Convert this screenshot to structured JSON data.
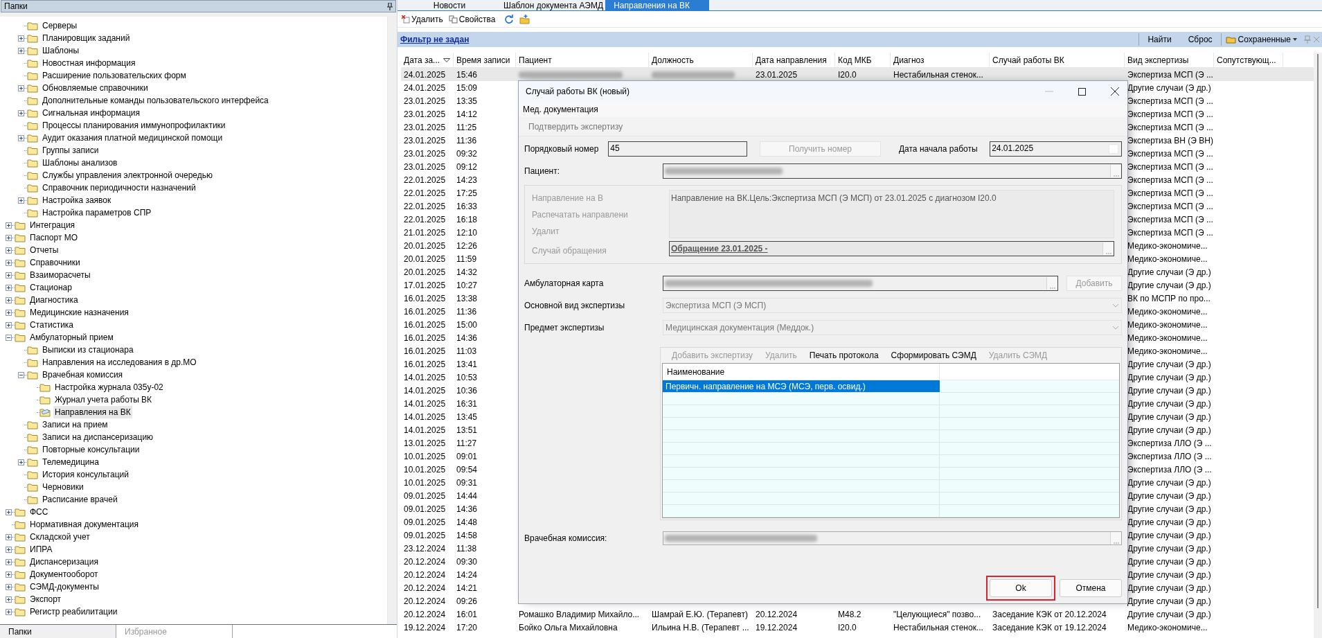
{
  "left_panel": {
    "title": "Папки",
    "tree_partial": [
      {
        "label": "Серверы",
        "kind": "leaf",
        "selected": false
      },
      {
        "label": "Планировщик заданий",
        "kind": "collapsed",
        "selected": false
      },
      {
        "label": "Шаблоны",
        "kind": "collapsed",
        "selected": false
      },
      {
        "label": "Новостная информация",
        "kind": "leaf",
        "selected": false
      },
      {
        "label": "Расширение пользовательских форм",
        "kind": "leaf",
        "selected": false
      },
      {
        "label": "Обновляемые справочники",
        "kind": "collapsed",
        "selected": false
      },
      {
        "label": "Дополнительные команды пользовательского интерфейса",
        "kind": "leaf",
        "selected": false
      },
      {
        "label": "Сигнальная информация",
        "kind": "collapsed",
        "selected": false
      },
      {
        "label": "Процессы планирования иммунопрофилактики",
        "kind": "leaf",
        "selected": false
      },
      {
        "label": "Аудит оказания платной медицинской помощи",
        "kind": "collapsed",
        "selected": false
      },
      {
        "label": "Группы записи",
        "kind": "leaf",
        "selected": false
      },
      {
        "label": "Шаблоны анализов",
        "kind": "leaf",
        "selected": false
      },
      {
        "label": "Службы управления электронной очередью",
        "kind": "leaf",
        "selected": false
      },
      {
        "label": "Справочник периодичности назначений",
        "kind": "leaf",
        "selected": false
      },
      {
        "label": "Настройка заявок",
        "kind": "collapsed",
        "selected": false
      },
      {
        "label": "Настройка параметров СПР",
        "kind": "leaf",
        "selected": false
      }
    ],
    "tree": [
      {
        "label": "Интеграция",
        "kind": "collapsed",
        "selected": false
      },
      {
        "label": "Паспорт МО",
        "kind": "collapsed",
        "selected": false
      },
      {
        "label": "Отчеты",
        "kind": "collapsed",
        "selected": false
      },
      {
        "label": "Справочники",
        "kind": "collapsed",
        "selected": false
      },
      {
        "label": "Взаиморасчеты",
        "kind": "collapsed",
        "selected": false
      },
      {
        "label": "Стационар",
        "kind": "collapsed",
        "selected": false
      },
      {
        "label": "Диагностика",
        "kind": "collapsed",
        "selected": false
      },
      {
        "label": "Медицинские назначения",
        "kind": "collapsed",
        "selected": false
      },
      {
        "label": "Статистика",
        "kind": "collapsed",
        "selected": false
      },
      {
        "label": "Амбулаторный прием",
        "kind": "expanded",
        "selected": false,
        "children": [
          {
            "label": "Выписки из стационара",
            "kind": "leaf",
            "selected": false
          },
          {
            "label": "Направления на исследования в др.МО",
            "kind": "leaf",
            "selected": false
          },
          {
            "label": "Врачебная комиссия",
            "kind": "expanded",
            "selected": false,
            "children": [
              {
                "label": "Настройка журнала 035у-02",
                "kind": "leaf",
                "selected": false
              },
              {
                "label": "Журнал учета работы ВК",
                "kind": "leaf",
                "selected": false
              },
              {
                "label": "Направления на ВК",
                "kind": "leaf",
                "selected": true
              }
            ]
          },
          {
            "label": "Записи на прием",
            "kind": "leaf",
            "selected": false
          },
          {
            "label": "Записи на диспансеризацию",
            "kind": "leaf",
            "selected": false
          },
          {
            "label": "Повторные консультации",
            "kind": "leaf",
            "selected": false
          },
          {
            "label": "Телемедицина",
            "kind": "collapsed",
            "selected": false
          },
          {
            "label": "История консультаций",
            "kind": "leaf",
            "selected": false
          },
          {
            "label": "Черновики",
            "kind": "leaf",
            "selected": false
          },
          {
            "label": "Расписание врачей",
            "kind": "leaf",
            "selected": false
          }
        ]
      },
      {
        "label": "ФСС",
        "kind": "collapsed",
        "selected": false
      },
      {
        "label": "Нормативная документация",
        "kind": "leaf",
        "selected": false
      },
      {
        "label": "Складской учет",
        "kind": "collapsed",
        "selected": false
      },
      {
        "label": "ИПРА",
        "kind": "collapsed",
        "selected": false
      },
      {
        "label": "Диспансеризация",
        "kind": "collapsed",
        "selected": false
      },
      {
        "label": "Документооборот",
        "kind": "collapsed",
        "selected": false
      },
      {
        "label": "СЭМД-документы",
        "kind": "collapsed",
        "selected": false
      },
      {
        "label": "Экспорт",
        "kind": "collapsed",
        "selected": false
      },
      {
        "label": "Регистр реабилитации",
        "kind": "collapsed",
        "selected": false
      }
    ],
    "bottom_tabs": [
      {
        "label": "Папки",
        "selected": true
      },
      {
        "label": "Избранное",
        "selected": false
      }
    ]
  },
  "tabs": [
    {
      "label": "Новости",
      "selected": false
    },
    {
      "label": "Шаблон документа АЭМД",
      "selected": false
    },
    {
      "label": "Направления на ВК",
      "selected": true
    }
  ],
  "toolbar": [
    {
      "kind": "delete",
      "label": "Удалить"
    },
    {
      "kind": "properties",
      "label": "Свойства"
    },
    {
      "kind": "refresh"
    },
    {
      "kind": "folder"
    }
  ],
  "filter_bar": {
    "filter_link": "Фильтр не задан",
    "find": "Найти",
    "reset": "Сброс",
    "saved": "Сохраненные"
  },
  "table": {
    "columns": [
      "Дата за...",
      "Время записи",
      "Пациент",
      "Должность",
      "Дата направления",
      "Код МКБ",
      "Диагноз",
      "Случай работы ВК",
      "Вид экспертизы",
      "Сопутствующ..."
    ],
    "rows": [
      {
        "selected": true,
        "blurred": true,
        "date": "24.01.2025",
        "time": "15:46",
        "referral_date": "23.01.2025",
        "icd": "I20.0",
        "diagnosis": "Нестабильная стенок...",
        "exam_type": "Экспертиза МСП (Э ..."
      },
      {
        "selected": false,
        "blurred": false,
        "date": "24.01.2025",
        "time": "15:09",
        "exam_type": "Другие случаи (Э др.)"
      },
      {
        "selected": false,
        "blurred": false,
        "date": "23.01.2025",
        "time": "13:35",
        "exam_type": "Экспертиза МСП (Э ..."
      },
      {
        "selected": false,
        "blurred": false,
        "date": "23.01.2025",
        "time": "14:12",
        "exam_type": "Экспертиза МСП (Э ..."
      },
      {
        "selected": false,
        "blurred": false,
        "date": "23.01.2025",
        "time": "11:25",
        "exam_type": "Экспертиза МСП (Э ..."
      },
      {
        "selected": false,
        "blurred": false,
        "date": "23.01.2025",
        "time": "11:36",
        "exam_type": "Экспертиза ВН (Э ВН)"
      },
      {
        "selected": false,
        "blurred": false,
        "date": "23.01.2025",
        "time": "09:32",
        "exam_type": "Экспертиза МСП (Э ..."
      },
      {
        "selected": false,
        "blurred": false,
        "date": "23.01.2025",
        "time": "09:12",
        "exam_type": "Экспертиза МСП (Э ..."
      },
      {
        "selected": false,
        "blurred": false,
        "date": "22.01.2025",
        "time": "14:23",
        "exam_type": "Экспертиза МСП (Э ..."
      },
      {
        "selected": false,
        "blurred": false,
        "date": "22.01.2025",
        "time": "17:25",
        "exam_type": "Экспертиза МСП (Э ..."
      },
      {
        "selected": false,
        "blurred": false,
        "date": "22.01.2025",
        "time": "16:33",
        "exam_type": "Экспертиза МСП (Э ..."
      },
      {
        "selected": false,
        "blurred": false,
        "date": "22.01.2025",
        "time": "16:18",
        "exam_type": "Экспертиза МСП (Э ..."
      },
      {
        "selected": false,
        "blurred": false,
        "date": "21.01.2025",
        "time": "12:10",
        "exam_type": "Экспертиза МСП (Э ..."
      },
      {
        "selected": false,
        "blurred": false,
        "date": "20.01.2025",
        "time": "12:26",
        "exam_type": "Медико-экономиче..."
      },
      {
        "selected": false,
        "blurred": false,
        "date": "20.01.2025",
        "time": "11:59",
        "exam_type": "Медико-экономиче..."
      },
      {
        "selected": false,
        "blurred": false,
        "date": "20.01.2025",
        "time": "14:32",
        "exam_type": "Другие случаи (Э др.)"
      },
      {
        "selected": false,
        "blurred": false,
        "date": "17.01.2025",
        "time": "10:27",
        "exam_type": "Другие случаи (Э др.)"
      },
      {
        "selected": false,
        "blurred": false,
        "date": "16.01.2025",
        "time": "13:38",
        "exam_type": "ВК по МСПР по про..."
      },
      {
        "selected": false,
        "blurred": false,
        "date": "16.01.2025",
        "time": "11:36",
        "exam_type": "Медико-экономиче..."
      },
      {
        "selected": false,
        "blurred": false,
        "date": "16.01.2025",
        "time": "15:00",
        "exam_type": "Медико-экономиче..."
      },
      {
        "selected": false,
        "blurred": false,
        "date": "16.01.2025",
        "time": "14:36",
        "exam_type": "Медико-экономиче..."
      },
      {
        "selected": false,
        "blurred": false,
        "date": "16.01.2025",
        "time": "11:03",
        "exam_type": "Медико-экономиче..."
      },
      {
        "selected": false,
        "blurred": false,
        "date": "16.01.2025",
        "time": "13:41",
        "exam_type": "Другие случаи (Э др.)"
      },
      {
        "selected": false,
        "blurred": false,
        "date": "14.01.2025",
        "time": "10:53",
        "exam_type": "Другие случаи (Э др.)"
      },
      {
        "selected": false,
        "blurred": false,
        "date": "14.01.2025",
        "time": "10:36",
        "exam_type": "Другие случаи (Э др.)"
      },
      {
        "selected": false,
        "blurred": false,
        "date": "14.01.2025",
        "time": "16:31",
        "exam_type": "Другие случаи (Э др.)"
      },
      {
        "selected": false,
        "blurred": false,
        "date": "14.01.2025",
        "time": "13:45",
        "exam_type": "Другие случаи (Э др.)"
      },
      {
        "selected": false,
        "blurred": false,
        "date": "14.01.2025",
        "time": "13:51",
        "exam_type": "Другие случаи (Э др.)"
      },
      {
        "selected": false,
        "blurred": false,
        "date": "13.01.2025",
        "time": "11:27",
        "exam_type": "Экспертиза ЛЛО (Э ..."
      },
      {
        "selected": false,
        "blurred": false,
        "date": "10.01.2025",
        "time": "09:01",
        "exam_type": "Экспертиза ЛЛО (Э ..."
      },
      {
        "selected": false,
        "blurred": false,
        "date": "10.01.2025",
        "time": "09:54",
        "exam_type": "Экспертиза ЛЛО (Э ..."
      },
      {
        "selected": false,
        "blurred": false,
        "date": "10.01.2025",
        "time": "09:31",
        "exam_type": "Другие случаи (Э др.)"
      },
      {
        "selected": false,
        "blurred": false,
        "date": "09.01.2025",
        "time": "14:44",
        "exam_type": "Другие случаи (Э др.)"
      },
      {
        "selected": false,
        "blurred": false,
        "date": "09.01.2025",
        "time": "14:36",
        "exam_type": "Другие случаи (Э др.)"
      },
      {
        "selected": false,
        "blurred": false,
        "date": "09.01.2025",
        "time": "14:48",
        "exam_type": "Другие случаи (Э др.)"
      },
      {
        "selected": false,
        "blurred": false,
        "date": "09.01.2025",
        "time": "14:58",
        "exam_type": "Другие случаи (Э др.)"
      },
      {
        "selected": false,
        "blurred": false,
        "date": "23.12.2024",
        "time": "11:38",
        "exam_type": "Другие случаи (Э др.)"
      },
      {
        "selected": false,
        "blurred": false,
        "date": "20.12.2024",
        "time": "09:30",
        "exam_type": "Другие случаи (Э др.)"
      },
      {
        "selected": false,
        "blurred": false,
        "date": "20.12.2024",
        "time": "14:24",
        "exam_type": "Другие случаи (Э др.)"
      },
      {
        "selected": false,
        "blurred": false,
        "date": "20.12.2024",
        "time": "14:21",
        "exam_type": "Другие случаи (Э др.)"
      },
      {
        "selected": false,
        "blurred": false,
        "date": "20.12.2024",
        "time": "09:26",
        "exam_type": "Другие случаи (Э др.)"
      },
      {
        "selected": false,
        "blurred": false,
        "date": "20.12.2024",
        "time": "16:01",
        "patient": "Ромашко Владимир Михайло...",
        "position": "Шамрай Е.Ю. (Терапевт)",
        "referral_date": "20.12.2024",
        "icd": "M48.2",
        "diagnosis": "\"Целующиеся\" позво...",
        "vk_case": "Заседание КЭК от 20.12.2024",
        "exam_type": "Другие случаи (Э др.)"
      },
      {
        "selected": false,
        "blurred": false,
        "date": "19.12.2024",
        "time": "17:20",
        "patient": "Бойко Ольга Михайловна",
        "position": "Ильина Н.В. (Терапевт ...",
        "referral_date": "19.12.2024",
        "icd": "I20.0",
        "diagnosis": "Нестабильная стенок...",
        "vk_case": "Заседание КЭК от 19.12.2024",
        "exam_type": "Медико-экономиче..."
      }
    ]
  },
  "dialog": {
    "title": "Случай работы ВК (новый)",
    "menu": "Мед. документация",
    "confirm_action": "Подтвердить экспертизу",
    "serial_label": "Порядковый номер",
    "serial_value": "45",
    "get_number": "Получить номер",
    "start_date_label": "Дата начала работы",
    "start_date_value": "24.01.2025",
    "patient_label": "Пациент:",
    "group_links": [
      "Направление на В",
      "Распечатать направлени",
      "Удалит"
    ],
    "referral_text": "Направление на ВК.Цель:Экспертиза МСП (Э МСП) от 23.01.2025 с диагнозом I20.0",
    "case_label": "Случай обращения",
    "case_value": "Обращение 23.01.2025 -",
    "card_label": "Амбулаторная карта",
    "add_button": "Добавить",
    "main_type_label": "Основной вид экспертизы",
    "main_type_value": "Экспертиза МСП (Э МСП)",
    "subject_label": "Предмет экспертизы",
    "subject_value": "Медицинская документация (Меддок.)",
    "sub_toolbar": [
      {
        "label": "Добавить экспертизу",
        "disabled": true
      },
      {
        "label": "Удалить",
        "disabled": true
      },
      {
        "label": "Печать протокола",
        "disabled": false
      },
      {
        "label": "Сформировать СЭМД",
        "disabled": false
      },
      {
        "label": "Удалить СЭМД",
        "disabled": true
      }
    ],
    "grid_header": "Наименование",
    "grid_rows": [
      {
        "name": "Первичн. направление на МСЭ (МСЭ, перв. освид.)",
        "selected": true
      }
    ],
    "commission_label": "Врачебная комиссия:",
    "ok": "Ok",
    "cancel": "Отмена",
    "ok_highlighted": true
  }
}
